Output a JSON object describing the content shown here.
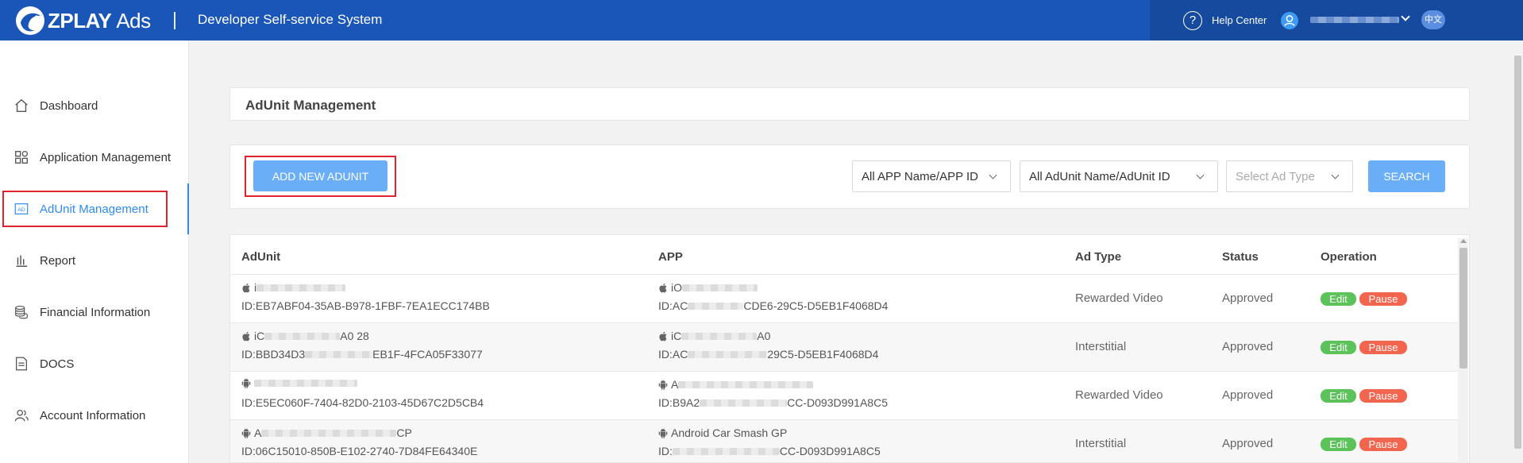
{
  "header": {
    "brand_name": "ZPLAY",
    "brand_suffix": "Ads",
    "system_title": "Developer Self-service System",
    "help_label": "Help Center",
    "lang_label": "中文",
    "icons": [
      "help-circle-icon",
      "user-icon",
      "chevron-down-icon"
    ]
  },
  "sidebar": {
    "items": [
      {
        "label": "Dashboard",
        "icon": "home-icon"
      },
      {
        "label": "Application Management",
        "icon": "grid-icon"
      },
      {
        "label": "AdUnit Management",
        "icon": "ad-icon",
        "active": true
      },
      {
        "label": "Report",
        "icon": "bar-chart-icon"
      },
      {
        "label": "Financial Information",
        "icon": "coins-icon"
      },
      {
        "label": "DOCS",
        "icon": "document-icon"
      },
      {
        "label": "Account Information",
        "icon": "users-icon"
      }
    ]
  },
  "page": {
    "title": "AdUnit Management"
  },
  "toolbar": {
    "add_label": "ADD NEW ADUNIT",
    "app_filter": "All APP Name/APP ID",
    "adunit_filter": "All AdUnit Name/AdUnit ID",
    "adtype_placeholder": "Select Ad Type",
    "search_label": "SEARCH"
  },
  "table": {
    "headers": [
      "AdUnit",
      "APP",
      "Ad Type",
      "Status",
      "Operation"
    ],
    "rows": [
      {
        "platform": "ios",
        "adunit_name": "i",
        "adunit_id": "ID:EB7ABF04-35AB-B978-1FBF-7EA1ECC174BB",
        "app_name": "iO",
        "app_id": "ID:AC",
        "app_id_tail": "CDE6-29C5-D5EB1F4068D4",
        "ad_type": "Rewarded Video",
        "status": "Approved",
        "edit_label": "Edit",
        "pause_label": "Pause"
      },
      {
        "platform": "ios",
        "adunit_name": "iC",
        "adunit_name_tail": "A0 28",
        "adunit_id": "ID:BBD34D3",
        "adunit_id_tail": "EB1F-4FCA05F33077",
        "app_name": "iC",
        "app_name_tail": "A0",
        "app_id": "ID:AC",
        "app_id_tail": "29C5-D5EB1F4068D4",
        "ad_type": "Interstitial",
        "status": "Approved",
        "edit_label": "Edit",
        "pause_label": "Pause"
      },
      {
        "platform": "android",
        "adunit_name": "",
        "adunit_id": "ID:E5EC060F-7404-82D0-2103-45D67C2D5CB4",
        "app_name": "A",
        "app_id": "ID:B9A2",
        "app_id_tail": "CC-D093D991A8C5",
        "ad_type": "Rewarded Video",
        "status": "Approved",
        "edit_label": "Edit",
        "pause_label": "Pause"
      },
      {
        "platform": "android",
        "adunit_name": "A",
        "adunit_name_tail": "CP",
        "adunit_id": "ID:06C15010-850B-E102-2740-7D84FE64340E",
        "app_name": "Android Car Smash GP",
        "app_id": "ID:",
        "app_id_tail": "CC-D093D991A8C5",
        "ad_type": "Interstitial",
        "status": "Approved",
        "edit_label": "Edit",
        "pause_label": "Pause"
      }
    ]
  },
  "colors": {
    "header_bg": "#1a56b8",
    "accent": "#2f8bf0",
    "primary_button": "#6aaef8",
    "edit_tag": "#5cc35b",
    "pause_tag": "#f2664f",
    "highlight_box": "#e0242d"
  }
}
